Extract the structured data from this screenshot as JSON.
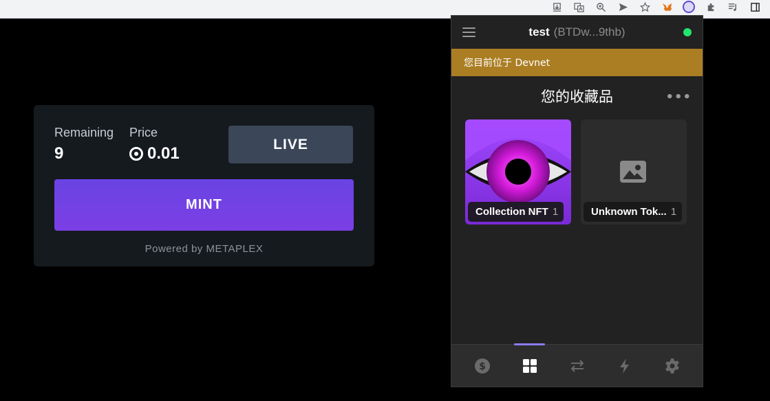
{
  "browser": {
    "toolbar_icons": [
      "download-icon",
      "translate-icon",
      "zoom-icon",
      "send-icon",
      "star-icon",
      "metamask-icon",
      "phantom-icon",
      "extensions-icon",
      "media-icon",
      "sidebar-icon"
    ]
  },
  "mint_card": {
    "remaining_label": "Remaining",
    "remaining_value": "9",
    "price_label": "Price",
    "price_value": "0.01",
    "currency_icon": "sol-icon",
    "live_label": "LIVE",
    "mint_label": "MINT",
    "powered_by": "Powered by METAPLEX",
    "colors": {
      "card_bg": "#151a1f",
      "mint_button": "#6a43e3",
      "live_button": "#3b4658"
    }
  },
  "wallet": {
    "account_name": "test",
    "account_address": "(BTDw...9thb)",
    "network_status_color": "#21e56f",
    "network_banner": "您目前位于 Devnet",
    "collectibles_title": "您的收藏品",
    "collections": [
      {
        "name": "Collection NFT",
        "count": "1"
      },
      {
        "name": "Unknown Tok...",
        "count": "1"
      }
    ],
    "footer_tabs": [
      "dollar-icon",
      "grid-icon",
      "swap-icon",
      "bolt-icon",
      "gear-icon"
    ],
    "active_tab": "grid-icon",
    "colors": {
      "banner": "#ab7e24",
      "accent": "#8a7cf0"
    }
  }
}
